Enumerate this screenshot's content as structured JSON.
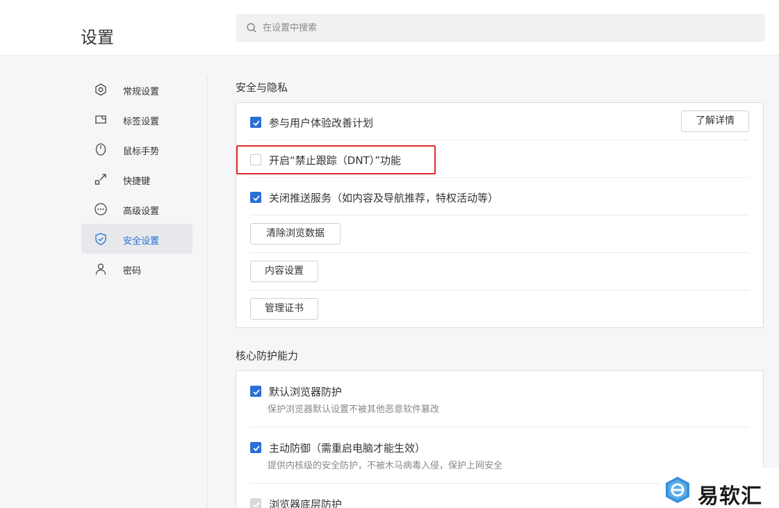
{
  "header": {
    "title": "设置",
    "search_placeholder": "在设置中搜索"
  },
  "sidebar": {
    "items": [
      {
        "label": "常规设置",
        "icon": "hexagon-settings-icon"
      },
      {
        "label": "标签设置",
        "icon": "tab-icon"
      },
      {
        "label": "鼠标手势",
        "icon": "mouse-icon"
      },
      {
        "label": "快捷键",
        "icon": "shortcut-arrow-icon"
      },
      {
        "label": "高级设置",
        "icon": "more-circle-icon"
      },
      {
        "label": "安全设置",
        "icon": "shield-icon",
        "active": true
      },
      {
        "label": "密码",
        "icon": "user-icon"
      }
    ]
  },
  "privacy": {
    "title": "安全与隐私",
    "ux_plan": {
      "label": "参与用户体验改善计划",
      "checked": true,
      "details_button": "了解详情"
    },
    "dnt": {
      "label": "开启“禁止跟踪（DNT）”功能",
      "checked": false
    },
    "push": {
      "label": "关闭推送服务（如内容及导航推荐，特权活动等）",
      "checked": true
    },
    "clear_data_button": "清除浏览数据",
    "content_settings_button": "内容设置",
    "manage_cert_button": "管理证书"
  },
  "protection": {
    "title": "核心防护能力",
    "items": [
      {
        "label": "默认浏览器防护",
        "sub": "保护浏览器默认设置不被其他恶意软件篡改",
        "checked": true
      },
      {
        "label": "主动防御（需重启电脑才能生效）",
        "sub": "提供内核级的安全防护，不被木马病毒入侵，保护上网安全",
        "checked": true
      },
      {
        "label": "浏览器底层防护",
        "checked": true,
        "disabled": true
      }
    ]
  },
  "watermark": {
    "text": "易软汇"
  },
  "colors": {
    "accent": "#2a6fd6",
    "highlight": "#e02b2b"
  }
}
